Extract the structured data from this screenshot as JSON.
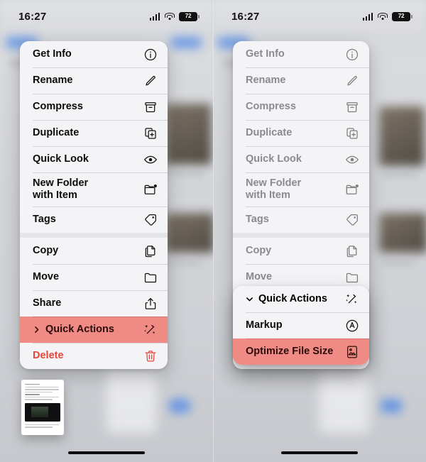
{
  "status_bar": {
    "time": "16:27",
    "battery_percent": "72",
    "cellular_icon": "signal-bars-icon",
    "wifi_icon": "wifi-icon",
    "battery_icon": "battery-icon"
  },
  "context_menu": {
    "items": [
      {
        "label": "Get Info",
        "icon": "info-circle-icon",
        "type": "normal"
      },
      {
        "label": "Rename",
        "icon": "pencil-icon",
        "type": "normal"
      },
      {
        "label": "Compress",
        "icon": "archive-box-icon",
        "type": "normal"
      },
      {
        "label": "Duplicate",
        "icon": "duplicate-icon",
        "type": "normal"
      },
      {
        "label": "Quick Look",
        "icon": "eye-icon",
        "type": "normal"
      },
      {
        "label": "New Folder\nwith Item",
        "icon": "folder-badge-plus-icon",
        "type": "normal"
      },
      {
        "label": "Tags",
        "icon": "tag-icon",
        "type": "normal"
      },
      {
        "label": "Copy",
        "icon": "copy-icon",
        "type": "normal"
      },
      {
        "label": "Move",
        "icon": "folder-icon",
        "type": "normal"
      },
      {
        "label": "Share",
        "icon": "share-icon",
        "type": "normal"
      },
      {
        "label": "Quick Actions",
        "icon": "magic-wand-icon",
        "type": "submenu-parent"
      },
      {
        "label": "Delete",
        "icon": "trash-icon",
        "type": "destructive"
      }
    ]
  },
  "submenu": {
    "header": {
      "label": "Quick Actions",
      "icon": "magic-wand-icon"
    },
    "items": [
      {
        "label": "Markup",
        "icon": "markup-pen-icon"
      },
      {
        "label": "Optimize File Size",
        "icon": "compress-image-icon"
      }
    ]
  },
  "colors": {
    "highlight": "#f08a84",
    "destructive_text": "#e8443a",
    "menu_background": "#f4f4f6",
    "separator": "#e6e6e9"
  },
  "panes": {
    "left_state": "context-menu-open-quick-actions-highlighted",
    "right_state": "submenu-open-optimize-file-size-highlighted"
  }
}
